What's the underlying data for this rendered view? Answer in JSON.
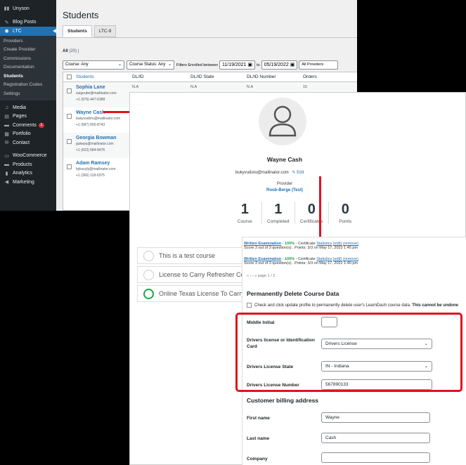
{
  "sidebar": {
    "items": [
      {
        "icon": "unyson-icon",
        "label": "Unyson"
      },
      {
        "icon": "pin-icon",
        "label": "Blog Posts"
      },
      {
        "icon": "ltc-icon",
        "label": "LTC"
      }
    ],
    "submenu": [
      "Providers",
      "Create Provider",
      "Commissions",
      "Documentation",
      "Students",
      "Registration Codes",
      "Settings"
    ],
    "items2": [
      {
        "icon": "media-icon",
        "label": "Media"
      },
      {
        "icon": "pages-icon",
        "label": "Pages"
      },
      {
        "icon": "comments-icon",
        "label": "Comments",
        "badge": "1"
      },
      {
        "icon": "portfolio-icon",
        "label": "Portfolio"
      },
      {
        "icon": "mail-icon",
        "label": "Contact"
      },
      {
        "icon": "woocommerce-icon",
        "label": "WooCommerce"
      },
      {
        "icon": "products-icon",
        "label": "Products"
      },
      {
        "icon": "analytics-icon",
        "label": "Analytics"
      },
      {
        "icon": "megaphone-icon",
        "label": "Marketing"
      }
    ]
  },
  "page": {
    "title": "Students",
    "tabs": [
      "Students",
      "LTC-9"
    ],
    "all_label": "All",
    "all_count": "(20)",
    "filters": {
      "course": "Course: Any",
      "status": "Course Status: Any",
      "enrolled_label": "Filters Enrolled between",
      "date_from": "11/19/2021",
      "to_label": "to",
      "date_to": "05/19/2022",
      "providers": "All Providers"
    },
    "columns": [
      "Students",
      "DL/ID",
      "DL/ID State",
      "DL/ID Number",
      "Orders"
    ],
    "rows": [
      {
        "name": "Sophia Lane",
        "email": "xuigoube@mailinator.com",
        "phone": "+1 (976) 447-6389",
        "dl": "N.A",
        "state": "N.A",
        "number": "N.A",
        "orders": "15"
      },
      {
        "name": "Wayne Cash",
        "email": "bukyvudoro@mailinator.com",
        "phone": "+1 (687) 655-8743"
      },
      {
        "name": "Georgia Bowman",
        "email": "gukepu@mailinator.com",
        "phone": "+1 (623) 584-8476"
      },
      {
        "name": "Adam Ramsey",
        "email": "bykucyly@mailinator.com",
        "phone": "+1 (366) 118-0375"
      }
    ]
  },
  "profile": {
    "name": "Wayne Cash",
    "email": "bukyvudoro@mailinator.com",
    "edit": "Edit",
    "provider_label": "Provider",
    "provider_name": "Roob-Berge (Test)",
    "stats": [
      {
        "value": "1",
        "label": "Course"
      },
      {
        "value": "1",
        "label": "Completed"
      },
      {
        "value": "0",
        "label": "Certificates"
      },
      {
        "value": "0",
        "label": "Points"
      }
    ],
    "courses": [
      "This is a test course",
      "License to Carry Refresher Course",
      "Online Texas License To Carry a"
    ]
  },
  "form": {
    "exams": [
      {
        "title": "Written Examination",
        "sep": " - ",
        "pct": "100%",
        "rest": " - Certificate",
        "links": [
          "Statistics",
          "(edit)",
          "(remove)"
        ],
        "score": "Score 3 out of 3 question(s) . Points: 3/3 on May 17, 2022 1:45 pm"
      },
      {
        "title": "Written Examination",
        "sep": " - ",
        "pct": "100%",
        "rest": " - Certificate",
        "links": [
          "Statistics",
          "(edit)",
          "(remove)"
        ],
        "score": "Score 3 out of 3 question(s) . Points: 3/3 on May 17, 2022 1:40 pm"
      }
    ],
    "pager": "« ‹ › » page 1 / 2",
    "delete_heading": "Permanently Delete Course Data",
    "delete_text": "Check and click update profile to permanently delete user's LearnDash course data.",
    "delete_warn": "This cannot be undone",
    "middle_initial_label": "Middle Initial",
    "middle_initial_value": "",
    "license_label": "Drivers license or Identification Card",
    "license_value": "Drivers License",
    "state_label": "Drivers License State",
    "state_value": "IN - Indiana",
    "number_label": "Drivers License Number",
    "number_value": "567890133",
    "billing_heading": "Customer billing address",
    "first_label": "First name",
    "first_value": "Wayne",
    "last_label": "Last name",
    "last_value": "Cash",
    "company_label": "Company",
    "company_value": ""
  },
  "colors": {
    "accent": "#2271b1",
    "highlight": "#e0131b",
    "success": "#1aa34a"
  }
}
